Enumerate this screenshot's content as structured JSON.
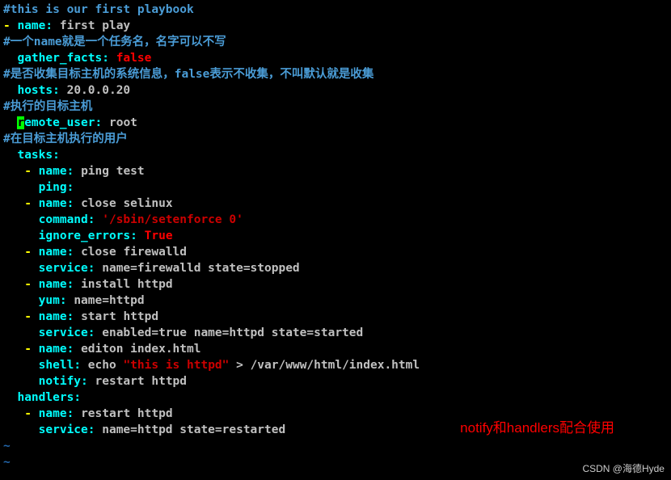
{
  "lines": {
    "c1": "#this is our first playbook",
    "name1_key": "name",
    "name1_val": "first play",
    "c2": "#一个name就是一个任务名，名字可以不写",
    "gather_key": "gather_facts",
    "gather_val": "false",
    "c3": "#是否收集目标主机的系统信息，false表示不收集，不叫默认就是收集",
    "hosts_key": "hosts",
    "hosts_val": "20.0.0.20",
    "c4": "#执行的目标主机",
    "remote_r": "r",
    "remote_rest": "emote_user",
    "remote_val": "root",
    "c5": "#在目标主机执行的用户",
    "tasks_key": "tasks",
    "t1_name_key": "name",
    "t1_name_val": "ping test",
    "t1_ping": "ping",
    "t2_name_key": "name",
    "t2_name_val": "close selinux",
    "t2_cmd_key": "command",
    "t2_cmd_val": "'/sbin/setenforce 0'",
    "t2_ign_key": "ignore_errors",
    "t2_ign_val": "True",
    "t3_name_key": "name",
    "t3_name_val": "close firewalld",
    "t3_svc_key": "service",
    "t3_svc_val": "name=firewalld state=stopped",
    "t4_name_key": "name",
    "t4_name_val": "install httpd",
    "t4_yum_key": "yum",
    "t4_yum_val": "name=httpd",
    "t5_name_key": "name",
    "t5_name_val": "start httpd",
    "t5_svc_key": "service",
    "t5_svc_val": "enabled=true name=httpd state=started",
    "t6_name_key": "name",
    "t6_name_val": "editon index.html",
    "t6_sh_key": "shell",
    "t6_sh_echo": "echo ",
    "t6_sh_str": "\"this is httpd\"",
    "t6_sh_rest": " > /var/www/html/index.html",
    "t6_not_key": "notify",
    "t6_not_val": "restart httpd",
    "handlers_key": "handlers",
    "h1_name_key": "name",
    "h1_name_val": "restart httpd",
    "h1_svc_key": "service",
    "h1_svc_val": "name=httpd state=restarted",
    "tilde": "~"
  },
  "annotation": "notify和handlers配合使用",
  "watermark": "CSDN @海德Hyde"
}
